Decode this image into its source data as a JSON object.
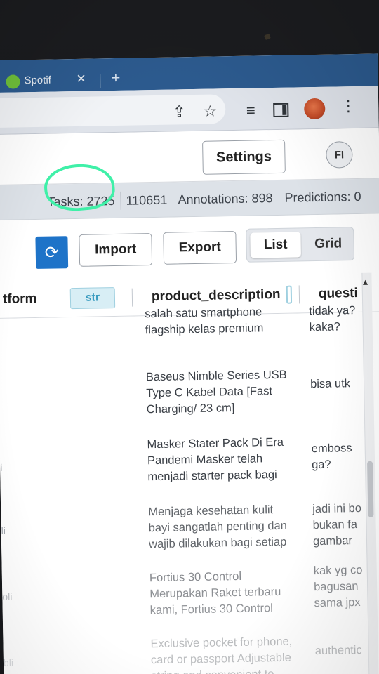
{
  "browser": {
    "tab_title": "Spotif",
    "tab_close": "✕",
    "new_tab": "+",
    "toolbar_icons": [
      "share-icon",
      "star-icon",
      "playlist-icon",
      "side-panel-icon",
      "profile-avatar",
      "kebab-menu-icon"
    ]
  },
  "header": {
    "settings_label": "Settings",
    "user_initials": "FI"
  },
  "stats": {
    "tasks": "Tasks: 2725",
    "sub": "110651",
    "annotations": "Annotations: 898",
    "predictions": "Predictions: 0"
  },
  "actions": {
    "refresh_icon": "refresh-icon",
    "import_label": "Import",
    "export_label": "Export",
    "view_list": "List",
    "view_grid": "Grid"
  },
  "table": {
    "columns": {
      "platform": "tform",
      "platform_type": "str",
      "description": "product_description",
      "question": "questi"
    },
    "rows": [
      {
        "desc_lines": [
          "salah satu smartphone",
          "flagship kelas premium"
        ],
        "question": [
          "tidak ya?",
          "kaka?"
        ],
        "left": ""
      },
      {
        "desc_lines": [
          "Baseus Nimble Series USB",
          "Type C Kabel Data [Fast",
          "Charging/ 23 cm]"
        ],
        "question": [
          "bisa utk"
        ],
        "left": ""
      },
      {
        "desc_lines": [
          "Masker Stater Pack Di Era",
          "Pandemi Masker telah",
          "menjadi starter pack bagi"
        ],
        "question": [
          "emboss",
          "ga?"
        ],
        "left": "i"
      },
      {
        "desc_lines": [
          "Menjaga kesehatan kulit",
          "bayi sangatlah penting dan",
          "wajib dilakukan bagi setiap"
        ],
        "question": [
          "jadi ini bo",
          "bukan fa",
          "gambar"
        ],
        "left": "li"
      },
      {
        "desc_lines": [
          "Fortius 30 Control",
          "Merupakan Raket terbaru",
          "kami, Fortius 30 Control"
        ],
        "question": [
          "kak yg co",
          "bagusan",
          "sama jpx"
        ],
        "left": "oli"
      },
      {
        "desc_lines": [
          "Exclusive pocket for phone,",
          "card or passport Adjustable",
          "string and convenient to"
        ],
        "question": [
          "authentic"
        ],
        "left": "bli"
      }
    ]
  }
}
